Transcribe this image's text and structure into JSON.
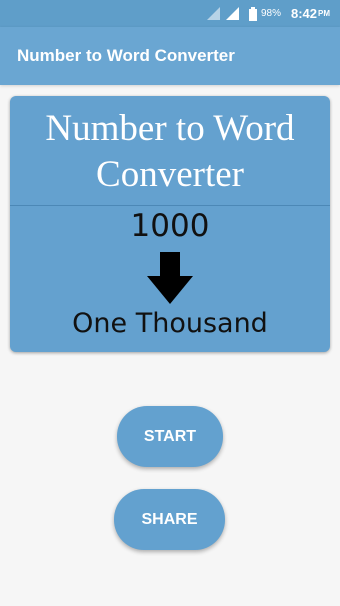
{
  "status_bar": {
    "battery_percent": "98%",
    "time": "8:42",
    "ampm": "PM",
    "icons": [
      "signal-icon",
      "signal-icon",
      "battery-icon"
    ]
  },
  "app_bar": {
    "title": "Number to Word Converter"
  },
  "banner": {
    "title_line1": "Number to Word",
    "title_line2": "Converter",
    "number": "1000",
    "words": "One Thousand",
    "arrow_icon": "arrow-down-icon"
  },
  "buttons": {
    "start_label": "START",
    "share_label": "SHARE"
  },
  "colors": {
    "status_bar": "#5f9ec9",
    "app_bar": "#6aa6d2",
    "accent": "#64a1cf",
    "background": "#f6f6f6"
  }
}
